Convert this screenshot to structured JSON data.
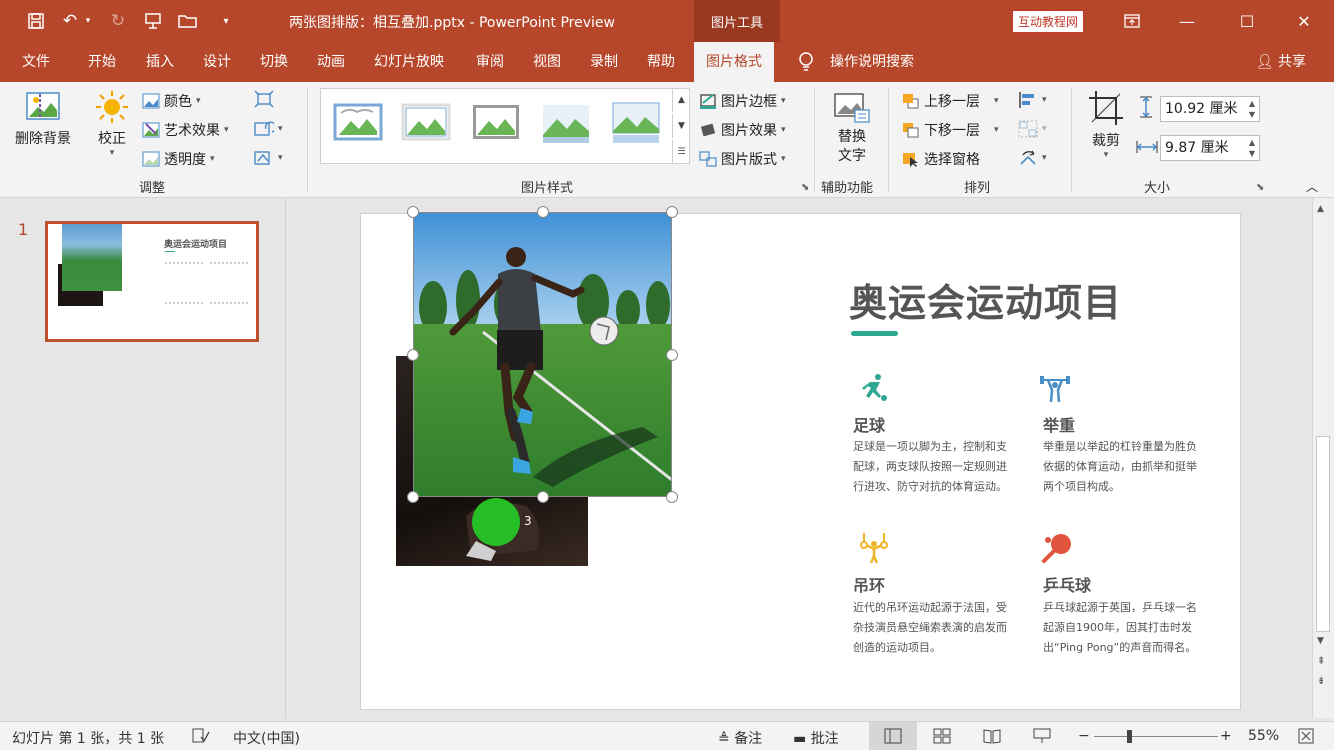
{
  "titlebar": {
    "doc_title": "两张图排版：相互叠加.pptx  -  PowerPoint Preview",
    "tool_tab": "图片工具",
    "tutorial_badge": "互动教程网"
  },
  "tabs": [
    "文件",
    "开始",
    "插入",
    "设计",
    "切换",
    "动画",
    "幻灯片放映",
    "审阅",
    "视图",
    "录制",
    "帮助",
    "图片格式"
  ],
  "active_tab": "图片格式",
  "tell_me": "操作说明搜索",
  "share": "共享",
  "ribbon": {
    "adjust": {
      "remove_bg": "删除背景",
      "corrections": "校正",
      "color": "颜色",
      "artistic": "艺术效果",
      "transparency": "透明度",
      "label": "调整"
    },
    "styles": {
      "border": "图片边框",
      "effects": "图片效果",
      "layout": "图片版式",
      "label": "图片样式"
    },
    "accessibility": {
      "alt_text_line1": "替换",
      "alt_text_line2": "文字",
      "label": "辅助功能"
    },
    "arrange": {
      "bring_forward": "上移一层",
      "send_backward": "下移一层",
      "selection_pane": "选择窗格",
      "label": "排列"
    },
    "size": {
      "crop": "裁剪",
      "height": "10.92 厘米",
      "width": "9.87 厘米",
      "label": "大小"
    }
  },
  "thumbnail": {
    "number": "1",
    "title": "奥运会运动项目"
  },
  "slide": {
    "title": "奥运会运动项目",
    "badge_number": "3",
    "accent_color": "#2fa893",
    "sports": [
      {
        "name": "足球",
        "desc": "足球是一项以脚为主，控制和支配球，两支球队按照一定规则进行进攻、防守对抗的体育运动。",
        "icon": "soccer-player-icon",
        "color": "#2fa893"
      },
      {
        "name": "举重",
        "desc": "举重是以举起的杠铃重量为胜负依据的体育运动，由抓举和挺举两个项目构成。",
        "icon": "weightlifter-icon",
        "color": "#4a90c8"
      },
      {
        "name": "吊环",
        "desc": "近代的吊环运动起源于法国，受杂技演员悬空绳索表演的启发而创造的运动项目。",
        "icon": "rings-icon",
        "color": "#f0b429"
      },
      {
        "name": "乒乓球",
        "desc": "乒乓球起源于英国，乒乓球一名起源自1900年，因其打击时发出“Ping Pong”的声音而得名。",
        "icon": "ping-pong-icon",
        "color": "#e0533c"
      }
    ]
  },
  "statusbar": {
    "slide_info": "幻灯片 第 1 张，共 1 张",
    "language": "中文(中国)",
    "notes": "备注",
    "comments": "批注",
    "zoom": "55%",
    "zoom_level": 0.55
  }
}
